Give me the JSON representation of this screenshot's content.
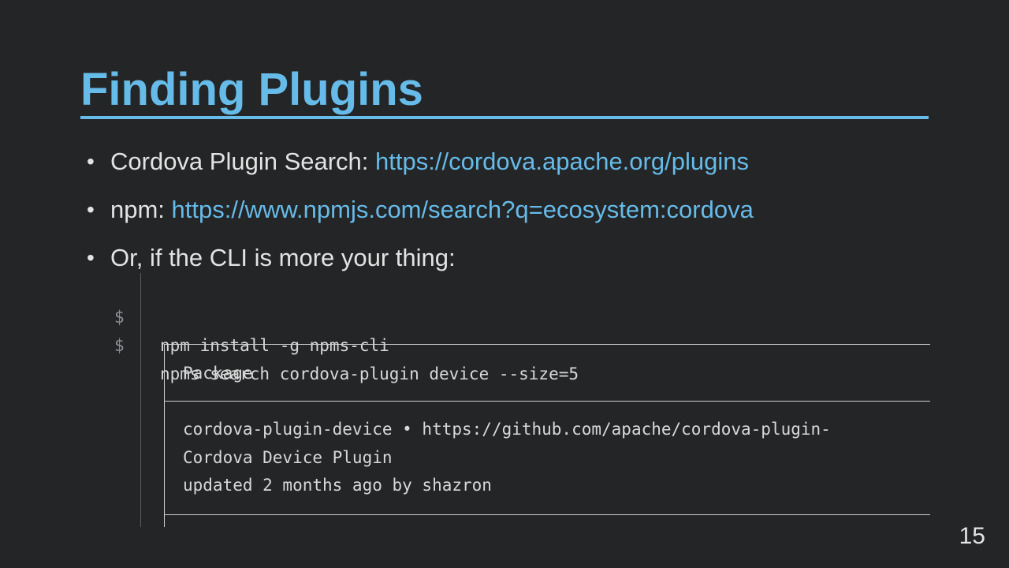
{
  "slide": {
    "title": "Finding Plugins",
    "page_number": "15"
  },
  "bullets": [
    {
      "label": "Cordova Plugin Search: ",
      "link": "https://cordova.apache.org/plugins"
    },
    {
      "label": "npm: ",
      "link": "https://www.npmjs.com/search?q=ecosystem:cordova"
    },
    {
      "label": "Or, if the CLI is more your thing:",
      "link": ""
    }
  ],
  "code": {
    "prompt": "$",
    "commands": [
      "npm install -g npms-cli",
      "npms search cordova-plugin device --size=5"
    ],
    "table": {
      "header": "Package",
      "rows": [
        "cordova-plugin-device • https://github.com/apache/cordova-plugin-",
        "Cordova Device Plugin",
        "updated 2 months ago by shazron"
      ]
    }
  },
  "colors": {
    "background": "#232527",
    "accent": "#67bbe8",
    "text": "#e3e3e3"
  }
}
